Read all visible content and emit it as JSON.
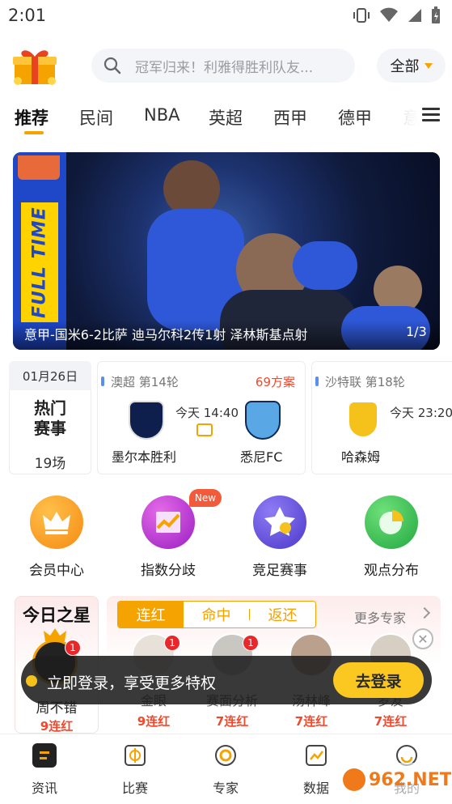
{
  "status_bar": {
    "time": "2:01"
  },
  "header": {
    "search_placeholder": "冠军归来！利雅得胜利队友...",
    "filter_label": "全部"
  },
  "tabs": [
    "推荐",
    "民间",
    "NBA",
    "英超",
    "西甲",
    "德甲",
    "意"
  ],
  "banner": {
    "badge_text": "FULL TIME",
    "caption": "意甲-国米6-2比萨 迪马尔科2传1射 泽林斯基点射",
    "page": "1/3"
  },
  "hot_matches": {
    "date": "01月26日",
    "title_line1": "热门",
    "title_line2": "赛事",
    "count": "19场"
  },
  "matches": [
    {
      "league": "澳超 第14轮",
      "plans": "69方案",
      "time": "今天 14:40",
      "home": "墨尔本胜利",
      "away": "悉尼FC"
    },
    {
      "league": "沙特联 第18轮",
      "time": "今天 23:20",
      "home": "哈森姆"
    }
  ],
  "features": [
    {
      "label": "会员中心",
      "icon": "crown-icon"
    },
    {
      "label": "指数分歧",
      "icon": "trend-chart-icon",
      "badge": "New"
    },
    {
      "label": "竞足赛事",
      "icon": "star-ball-icon"
    },
    {
      "label": "观点分布",
      "icon": "pie-chart-icon"
    }
  ],
  "star_today": {
    "title": "今日之星",
    "name": "周不错",
    "streak": "9连红",
    "badge": "1"
  },
  "expert_tabs": [
    "连红",
    "命中",
    "返还"
  ],
  "more_experts": "更多专家",
  "experts": [
    {
      "name": "金眼",
      "streak": "9连红",
      "badge": "1"
    },
    {
      "name": "赛面分析",
      "streak": "7连红",
      "badge": "1"
    },
    {
      "name": "汤林峰",
      "streak": "7连红"
    },
    {
      "name": "罗友",
      "streak": "7连红"
    }
  ],
  "toast": {
    "message": "立即登录，享受更多特权",
    "button": "去登录"
  },
  "bottom_nav": [
    "资讯",
    "比赛",
    "专家",
    "数据",
    "我的"
  ],
  "colors": {
    "accent": "#f5a300",
    "red": "#f04a2e"
  }
}
